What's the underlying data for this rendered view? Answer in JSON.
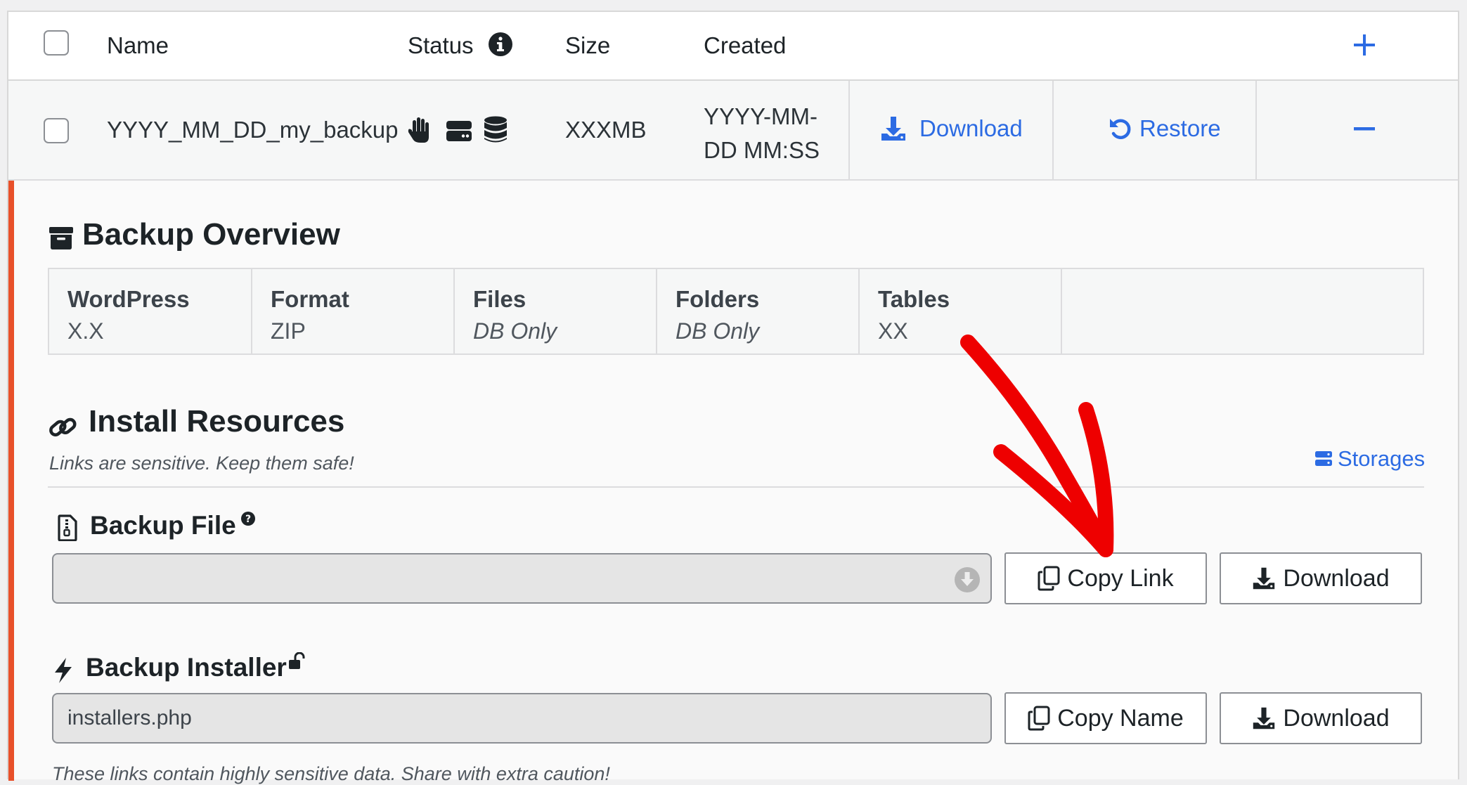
{
  "table": {
    "headers": {
      "name": "Name",
      "status": "Status",
      "size": "Size",
      "created": "Created"
    },
    "row": {
      "name": "YYYY_MM_DD_my_backup",
      "size": "XXXMB",
      "created_line1": "YYYY-MM-",
      "created_line2": "DD MM:SS",
      "download_label": "Download",
      "restore_label": "Restore"
    }
  },
  "overview": {
    "title": "Backup Overview",
    "columns": [
      {
        "label": "WordPress",
        "value": "X.X"
      },
      {
        "label": "Format",
        "value": "ZIP"
      },
      {
        "label": "Files",
        "value": "DB Only"
      },
      {
        "label": "Folders",
        "value": "DB Only"
      },
      {
        "label": "Tables",
        "value": "XX"
      }
    ]
  },
  "resources": {
    "title": "Install Resources",
    "subtitle": "Links are sensitive. Keep them safe!",
    "storages_label": "Storages",
    "backup_file": {
      "title": "Backup File",
      "value": "",
      "copy_label": "Copy Link",
      "download_label": "Download"
    },
    "backup_installer": {
      "title": "Backup Installer",
      "value": "installers.php",
      "copy_label": "Copy Name",
      "download_label": "Download"
    },
    "footer_note": "These links contain highly sensitive data. Share with extra caution!"
  },
  "colors": {
    "link_blue": "#2c6be3",
    "accent_border": "#e8502a",
    "annotation_arrow": "#ee0000"
  },
  "icons": {
    "status": [
      "hand-icon",
      "server-icon",
      "database-icon"
    ],
    "overview": "archive-icon",
    "resources": "link-icon",
    "storages": "server-icon",
    "backup_file": "file-zip-icon",
    "installer": "bolt-icon",
    "installer_badge": "unlock-icon"
  }
}
